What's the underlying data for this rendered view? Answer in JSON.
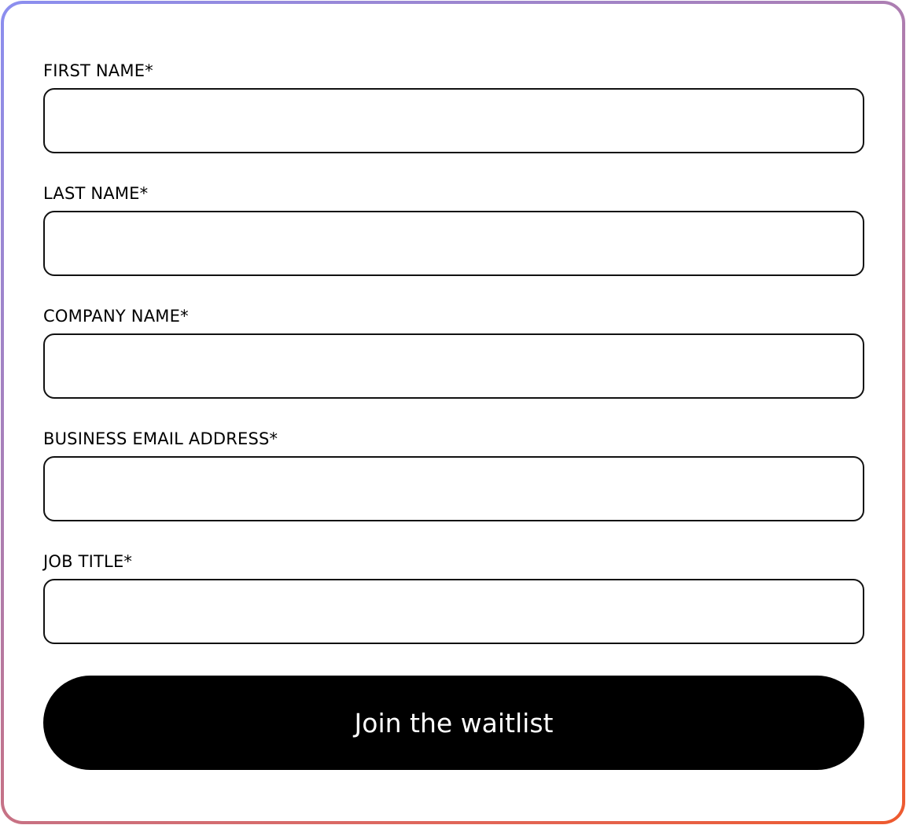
{
  "form": {
    "fields": [
      {
        "label": "FIRST NAME*",
        "value": ""
      },
      {
        "label": "LAST NAME*",
        "value": ""
      },
      {
        "label": "COMPANY NAME*",
        "value": ""
      },
      {
        "label": "BUSINESS EMAIL ADDRESS*",
        "value": ""
      },
      {
        "label": "JOB TITLE*",
        "value": ""
      }
    ],
    "submit_label": "Join the waitlist"
  },
  "colors": {
    "gradient_start": "#8b8ff0",
    "gradient_end": "#ee5a2e",
    "button_bg": "#000000",
    "button_text": "#ffffff"
  }
}
